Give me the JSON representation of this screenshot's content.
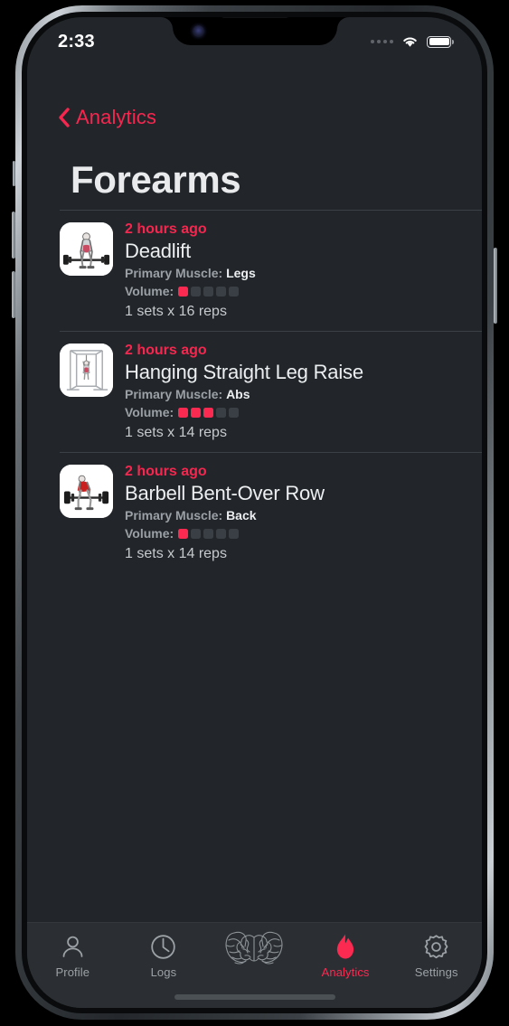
{
  "status_bar": {
    "time": "2:33",
    "signal_icon": "signal-dots-icon",
    "wifi_icon": "wifi-icon",
    "battery_icon": "battery-full-icon"
  },
  "nav": {
    "back_icon": "chevron-left-icon",
    "back_label": "Analytics"
  },
  "page": {
    "title": "Forearms"
  },
  "colors": {
    "accent": "#fb2a51",
    "background": "#22262a",
    "tab_bar": "#2b2f33",
    "pip_off": "#3a3f45",
    "separator": "#3b4046"
  },
  "exercises": [
    {
      "time": "2 hours ago",
      "name": "Deadlift",
      "muscle_label": "Primary Muscle:",
      "muscle_value": "Legs",
      "volume_label": "Volume:",
      "volume_filled": 1,
      "volume_total": 5,
      "sets_reps": "1 sets x 16 reps",
      "thumb_icon": "deadlift-thumbnail"
    },
    {
      "time": "2 hours ago",
      "name": "Hanging Straight Leg Raise",
      "muscle_label": "Primary Muscle:",
      "muscle_value": "Abs",
      "volume_label": "Volume:",
      "volume_filled": 3,
      "volume_total": 5,
      "sets_reps": "1 sets x 14 reps",
      "thumb_icon": "power-rack-thumbnail"
    },
    {
      "time": "2 hours ago",
      "name": "Barbell Bent-Over Row",
      "muscle_label": "Primary Muscle:",
      "muscle_value": "Back",
      "volume_label": "Volume:",
      "volume_filled": 1,
      "volume_total": 5,
      "sets_reps": "1 sets x 14 reps",
      "thumb_icon": "barbell-row-thumbnail"
    }
  ],
  "tab_bar": {
    "items": [
      {
        "label": "Profile",
        "icon": "person-icon",
        "active": false
      },
      {
        "label": "Logs",
        "icon": "clock-icon",
        "active": false
      },
      {
        "label": "",
        "icon": "brain-biceps-icon",
        "active": false
      },
      {
        "label": "Analytics",
        "icon": "flame-icon",
        "active": true
      },
      {
        "label": "Settings",
        "icon": "gear-icon",
        "active": false
      }
    ]
  }
}
